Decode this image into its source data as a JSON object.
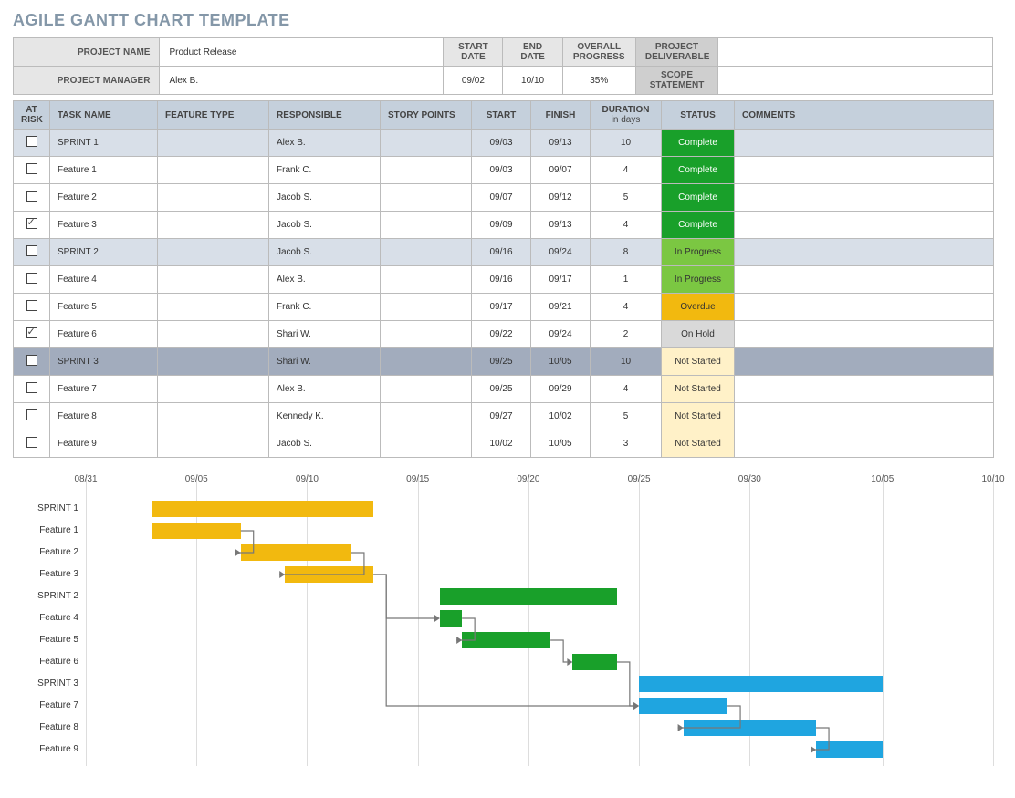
{
  "title": "AGILE GANTT CHART TEMPLATE",
  "header": {
    "labels": {
      "projectName": "PROJECT NAME",
      "projectManager": "PROJECT MANAGER",
      "startDate": "START DATE",
      "endDate": "END DATE",
      "overallProgress": "OVERALL PROGRESS",
      "projectDeliverable": "PROJECT DELIVERABLE",
      "scopeStatement": "SCOPE STATEMENT"
    },
    "projectName": "Product Release",
    "projectManager": "Alex B.",
    "startDate": "09/02",
    "endDate": "10/10",
    "overallProgress": "35%",
    "projectDeliverable": "",
    "scopeStatement": ""
  },
  "columns": {
    "atRisk": "AT RISK",
    "taskName": "TASK NAME",
    "featureType": "FEATURE TYPE",
    "responsible": "RESPONSIBLE",
    "storyPoints": "STORY POINTS",
    "start": "START",
    "finish": "FINISH",
    "duration": "DURATION",
    "durationSub": "in days",
    "status": "STATUS",
    "comments": "COMMENTS"
  },
  "status_colors": {
    "Complete": "st-complete",
    "In Progress": "st-progress",
    "Overdue": "st-overdue",
    "On Hold": "st-hold",
    "Not Started": "st-notstarted"
  },
  "tasks": [
    {
      "sprint": true,
      "atRisk": false,
      "name": "SPRINT 1",
      "featureType": "",
      "responsible": "Alex B.",
      "points": "",
      "start": "09/03",
      "finish": "09/13",
      "duration": "10",
      "status": "Complete"
    },
    {
      "atRisk": false,
      "name": "Feature 1",
      "featureType": "",
      "responsible": "Frank C.",
      "points": "",
      "start": "09/03",
      "finish": "09/07",
      "duration": "4",
      "status": "Complete"
    },
    {
      "atRisk": false,
      "name": "Feature 2",
      "featureType": "",
      "responsible": "Jacob S.",
      "points": "",
      "start": "09/07",
      "finish": "09/12",
      "duration": "5",
      "status": "Complete"
    },
    {
      "atRisk": true,
      "name": "Feature 3",
      "featureType": "",
      "responsible": "Jacob S.",
      "points": "",
      "start": "09/09",
      "finish": "09/13",
      "duration": "4",
      "status": "Complete"
    },
    {
      "sprint": true,
      "atRisk": false,
      "name": "SPRINT 2",
      "featureType": "",
      "responsible": "Jacob S.",
      "points": "",
      "start": "09/16",
      "finish": "09/24",
      "duration": "8",
      "status": "In Progress"
    },
    {
      "atRisk": false,
      "name": "Feature 4",
      "featureType": "",
      "responsible": "Alex B.",
      "points": "",
      "start": "09/16",
      "finish": "09/17",
      "duration": "1",
      "status": "In Progress"
    },
    {
      "atRisk": false,
      "name": "Feature 5",
      "featureType": "",
      "responsible": "Frank C.",
      "points": "",
      "start": "09/17",
      "finish": "09/21",
      "duration": "4",
      "status": "Overdue"
    },
    {
      "atRisk": true,
      "name": "Feature 6",
      "featureType": "",
      "responsible": "Shari W.",
      "points": "",
      "start": "09/22",
      "finish": "09/24",
      "duration": "2",
      "status": "On Hold"
    },
    {
      "sprint": true,
      "active": true,
      "atRisk": false,
      "name": "SPRINT 3",
      "featureType": "",
      "responsible": "Shari W.",
      "points": "",
      "start": "09/25",
      "finish": "10/05",
      "duration": "10",
      "status": "Not Started"
    },
    {
      "atRisk": false,
      "name": "Feature 7",
      "featureType": "",
      "responsible": "Alex B.",
      "points": "",
      "start": "09/25",
      "finish": "09/29",
      "duration": "4",
      "status": "Not Started"
    },
    {
      "atRisk": false,
      "name": "Feature 8",
      "featureType": "",
      "responsible": "Kennedy K.",
      "points": "",
      "start": "09/27",
      "finish": "10/02",
      "duration": "5",
      "status": "Not Started"
    },
    {
      "atRisk": false,
      "name": "Feature 9",
      "featureType": "",
      "responsible": "Jacob S.",
      "points": "",
      "start": "10/02",
      "finish": "10/05",
      "duration": "3",
      "status": "Not Started"
    }
  ],
  "chart_data": {
    "type": "gantt",
    "x_axis": {
      "start": "08/31",
      "end": "10/10",
      "ticks": [
        "08/31",
        "09/05",
        "09/10",
        "09/15",
        "09/20",
        "09/25",
        "09/30",
        "10/05",
        "10/10"
      ]
    },
    "rows": [
      "SPRINT 1",
      "Feature 1",
      "Feature 2",
      "Feature 3",
      "SPRINT 2",
      "Feature 4",
      "Feature 5",
      "Feature 6",
      "SPRINT 3",
      "Feature 7",
      "Feature 8",
      "Feature 9"
    ],
    "bars": [
      {
        "row": 0,
        "start": "09/03",
        "end": "09/13",
        "color": "orange"
      },
      {
        "row": 1,
        "start": "09/03",
        "end": "09/07",
        "color": "orange"
      },
      {
        "row": 2,
        "start": "09/07",
        "end": "09/12",
        "color": "orange"
      },
      {
        "row": 3,
        "start": "09/09",
        "end": "09/13",
        "color": "orange"
      },
      {
        "row": 4,
        "start": "09/16",
        "end": "09/24",
        "color": "green"
      },
      {
        "row": 5,
        "start": "09/16",
        "end": "09/17",
        "color": "green"
      },
      {
        "row": 6,
        "start": "09/17",
        "end": "09/21",
        "color": "green"
      },
      {
        "row": 7,
        "start": "09/22",
        "end": "09/24",
        "color": "green"
      },
      {
        "row": 8,
        "start": "09/25",
        "end": "10/05",
        "color": "blue"
      },
      {
        "row": 9,
        "start": "09/25",
        "end": "09/29",
        "color": "blue"
      },
      {
        "row": 10,
        "start": "09/27",
        "end": "10/02",
        "color": "blue"
      },
      {
        "row": 11,
        "start": "10/02",
        "end": "10/05",
        "color": "blue"
      }
    ],
    "dependencies": [
      {
        "from": 1,
        "to": 2
      },
      {
        "from": 2,
        "to": 3
      },
      {
        "from": 3,
        "to": 5
      },
      {
        "from": 5,
        "to": 6
      },
      {
        "from": 6,
        "to": 7
      },
      {
        "from": 7,
        "to": 9
      },
      {
        "from": 9,
        "to": 10
      },
      {
        "from": 10,
        "to": 11
      },
      {
        "from": 3,
        "to": 9
      }
    ]
  }
}
